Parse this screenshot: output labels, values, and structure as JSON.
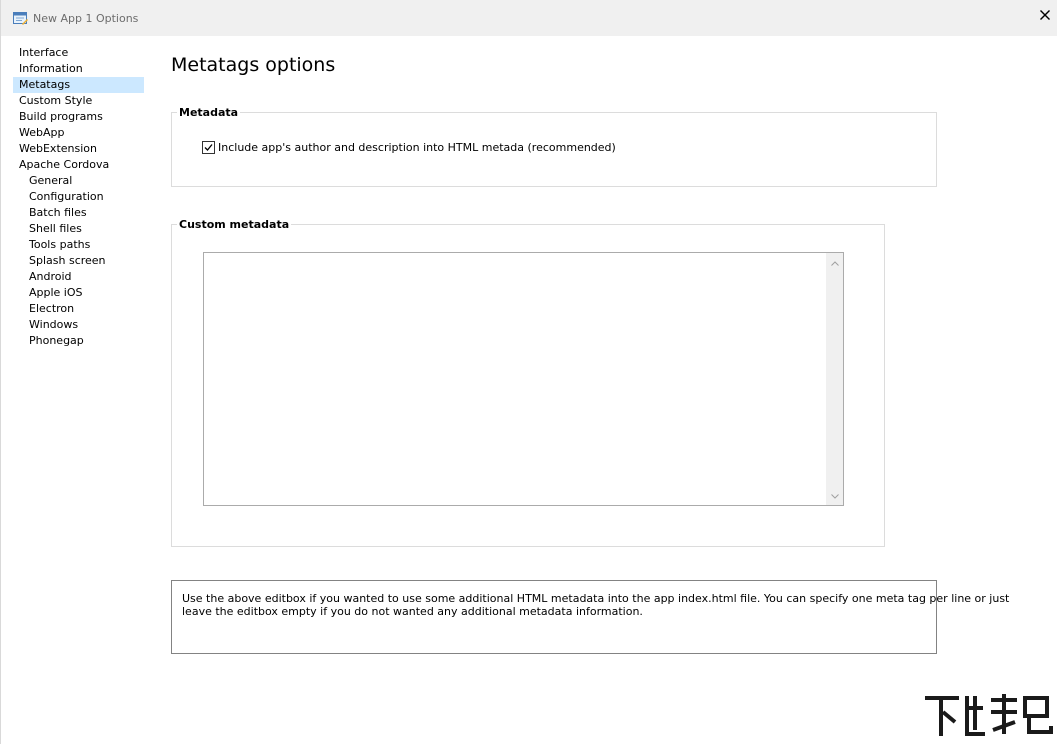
{
  "window": {
    "title": "New App 1 Options",
    "close_glyph": "✕"
  },
  "sidebar": {
    "items": [
      {
        "label": "Interface",
        "level": 0,
        "selected": false
      },
      {
        "label": "Information",
        "level": 0,
        "selected": false
      },
      {
        "label": "Metatags",
        "level": 0,
        "selected": true
      },
      {
        "label": "Custom Style",
        "level": 0,
        "selected": false
      },
      {
        "label": "Build programs",
        "level": 0,
        "selected": false
      },
      {
        "label": "WebApp",
        "level": 0,
        "selected": false
      },
      {
        "label": "WebExtension",
        "level": 0,
        "selected": false
      },
      {
        "label": "Apache Cordova",
        "level": 0,
        "selected": false
      },
      {
        "label": "General",
        "level": 1,
        "selected": false
      },
      {
        "label": "Configuration",
        "level": 1,
        "selected": false
      },
      {
        "label": "Batch files",
        "level": 1,
        "selected": false
      },
      {
        "label": "Shell files",
        "level": 1,
        "selected": false
      },
      {
        "label": "Tools paths",
        "level": 1,
        "selected": false
      },
      {
        "label": "Splash screen",
        "level": 1,
        "selected": false
      },
      {
        "label": "Android",
        "level": 1,
        "selected": false
      },
      {
        "label": "Apple iOS",
        "level": 1,
        "selected": false
      },
      {
        "label": "Electron",
        "level": 1,
        "selected": false
      },
      {
        "label": "Windows",
        "level": 1,
        "selected": false
      },
      {
        "label": "Phonegap",
        "level": 1,
        "selected": false
      }
    ],
    "selected_color": "#cce8ff"
  },
  "main": {
    "page_title": "Metatags options",
    "metadata_group": {
      "legend": "Metadata",
      "checkbox_label": "Include app's author and description into HTML metada (recommended)",
      "checked": true
    },
    "custom_group": {
      "legend": "Custom metadata",
      "editbox_value": ""
    },
    "info_text": {
      "line1": "Use the above editbox if you wanted to use some additional HTML metadata into the app index.html file. You can specify one meta tag per line or just",
      "line2": "leave the editbox empty if you do not wanted any additional metadata information."
    }
  },
  "icons": {
    "title_icon": "options-window-icon",
    "close_icon": "close-icon",
    "checkbox_icon": "checkmark-icon",
    "scroll_up_icon": "chevron-up-icon",
    "scroll_down_icon": "chevron-down-icon"
  }
}
